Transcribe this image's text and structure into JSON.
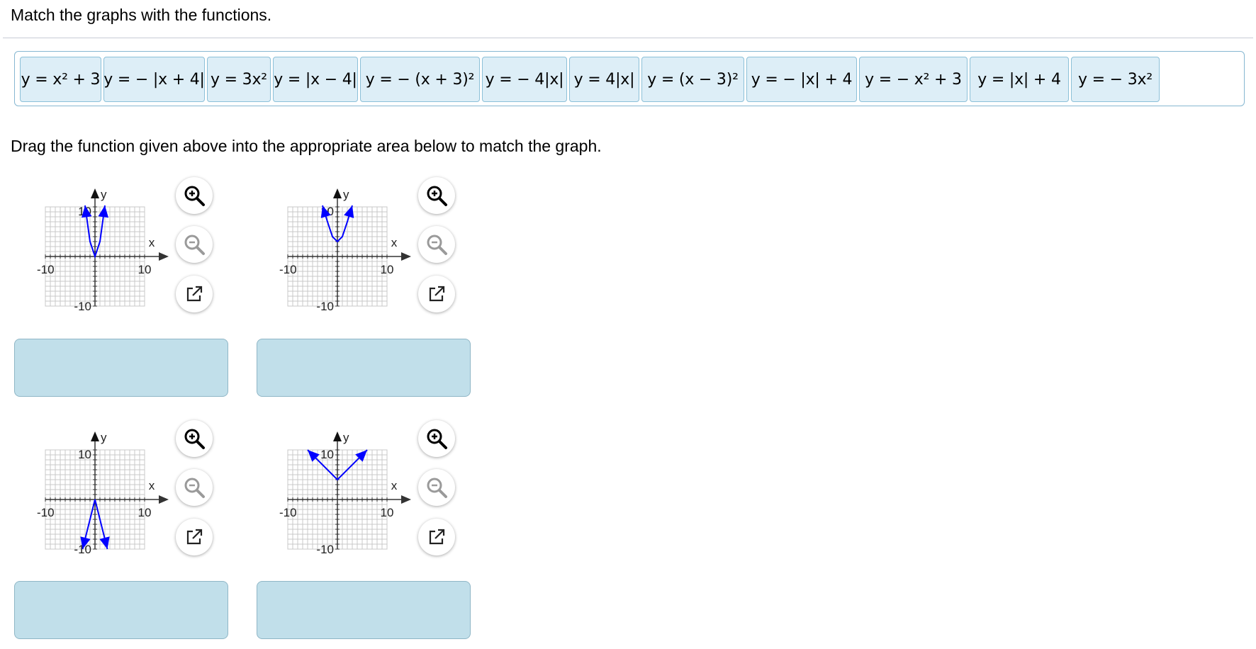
{
  "prompt": "Match the graphs with the functions.",
  "instruction": "Drag the function given above into the appropriate area below to match the graph.",
  "functions": [
    "y = x² + 3",
    "y = − |x + 4|",
    "y = 3x²",
    "y = |x − 4|",
    "y = − (x + 3)²",
    "y = − 4|x|",
    "y = 4|x|",
    "y = (x − 3)²",
    "y = − |x| + 4",
    "y = − x² + 3",
    "y = |x| + 4",
    "y = − 3x²"
  ],
  "graphs": [
    {
      "id": "graph-1",
      "x_label": "x",
      "y_label": "y",
      "x_min_label": "-10",
      "x_max_label": "10",
      "y_max_label": "10",
      "y_min_label": "-10",
      "drop_value": ""
    },
    {
      "id": "graph-2",
      "x_label": "x",
      "y_label": "y",
      "x_min_label": "-10",
      "x_max_label": "10",
      "y_max_label": "10",
      "y_min_label": "-10",
      "drop_value": ""
    },
    {
      "id": "graph-3",
      "x_label": "x",
      "y_label": "y",
      "x_min_label": "-10",
      "x_max_label": "10",
      "y_max_label": "10",
      "y_min_label": "-10",
      "drop_value": ""
    },
    {
      "id": "graph-4",
      "x_label": "x",
      "y_label": "y",
      "x_min_label": "-10",
      "x_max_label": "10",
      "y_max_label": "10",
      "y_min_label": "-10",
      "drop_value": ""
    }
  ],
  "chart_data": [
    {
      "type": "line",
      "curve": "parabola",
      "x_range": [
        -10,
        10
      ],
      "y_range": [
        -10,
        10
      ],
      "vertex": [
        0,
        0
      ],
      "opens": "up",
      "points": [
        [
          -2,
          12
        ],
        [
          -1,
          3
        ],
        [
          0,
          0
        ],
        [
          1,
          3
        ],
        [
          2,
          12
        ]
      ],
      "arrows": true
    },
    {
      "type": "line",
      "curve": "parabola",
      "x_range": [
        -10,
        10
      ],
      "y_range": [
        -10,
        10
      ],
      "vertex": [
        0,
        3
      ],
      "opens": "up",
      "points": [
        [
          -3,
          12
        ],
        [
          -2,
          7
        ],
        [
          -1,
          4
        ],
        [
          0,
          3
        ],
        [
          1,
          4
        ],
        [
          2,
          7
        ],
        [
          3,
          12
        ]
      ],
      "arrows": true
    },
    {
      "type": "line",
      "curve": "absolute-value",
      "x_range": [
        -10,
        10
      ],
      "y_range": [
        -10,
        10
      ],
      "vertex": [
        0,
        0
      ],
      "opens": "down",
      "points": [
        [
          -2.5,
          -10
        ],
        [
          0,
          0
        ],
        [
          2.5,
          -10
        ]
      ],
      "arrows": true
    },
    {
      "type": "line",
      "curve": "absolute-value",
      "x_range": [
        -10,
        10
      ],
      "y_range": [
        -10,
        10
      ],
      "vertex": [
        0,
        4
      ],
      "opens": "up",
      "points": [
        [
          -6,
          10
        ],
        [
          0,
          4
        ],
        [
          6,
          10
        ]
      ],
      "arrows": true
    }
  ],
  "icons": {
    "zoom_in": "zoom-in-icon",
    "zoom_out": "zoom-out-icon",
    "popout": "popout-icon"
  },
  "colors": {
    "curve": "#0000ff",
    "chip_fill": "#ddeef7",
    "chip_border": "#8cc0d8",
    "drop_fill": "#c1dfea",
    "drop_border": "#8fb6c6",
    "grid": "#c8c8c8"
  }
}
